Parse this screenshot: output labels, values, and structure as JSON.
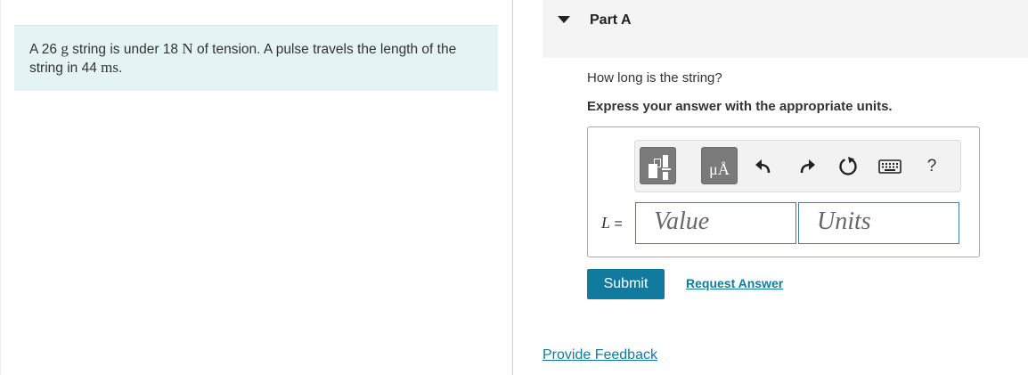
{
  "problem": {
    "text_1": "A 26 ",
    "unit_mass": "g",
    "text_2": " string is under 18 ",
    "unit_force": "N",
    "text_3": " of tension. A pulse travels the length of the string in 44 ",
    "unit_time": "ms",
    "text_4": "."
  },
  "part": {
    "title": "Part A",
    "question": "How long is the string?",
    "instruction": "Express your answer with the appropriate units."
  },
  "answer": {
    "variable": "L",
    "equals": "=",
    "value_placeholder": "Value",
    "units_placeholder": "Units"
  },
  "toolbar": {
    "units_glyph": "μÅ",
    "help_label": "?"
  },
  "actions": {
    "submit_label": "Submit",
    "request_answer_label": "Request Answer",
    "provide_feedback_label": "Provide Feedback"
  },
  "colors": {
    "problem_background": "#e4f4f4",
    "accent": "#117a9f",
    "input_border": "#3d7fa3",
    "template_button": "#7a7a7a"
  }
}
